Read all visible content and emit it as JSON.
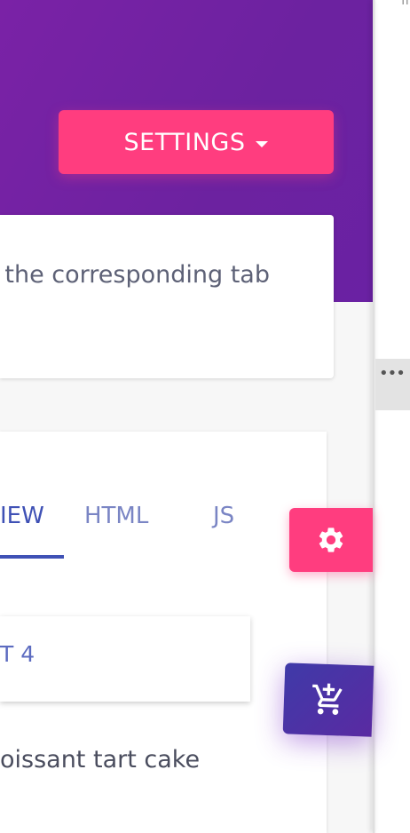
{
  "header": {
    "settings_label": "SETTINGS"
  },
  "info_card": {
    "text": "the corresponding tab"
  },
  "tabs": [
    {
      "label": "IEW"
    },
    {
      "label": "HTML"
    },
    {
      "label": "JS"
    }
  ],
  "inner_card": {
    "text": "T 4"
  },
  "description": "oissant tart cake",
  "right_panel": {
    "more_label": "•••"
  },
  "icons": {
    "settings_fab": "gear-icon",
    "cart_fab": "cart-plus-icon",
    "dropdown": "caret-down-icon"
  },
  "colors": {
    "header": "#6c22a0",
    "accent": "#ff3d7f",
    "tab_active": "#3f51b5",
    "cart_button": "#4a32a6"
  }
}
